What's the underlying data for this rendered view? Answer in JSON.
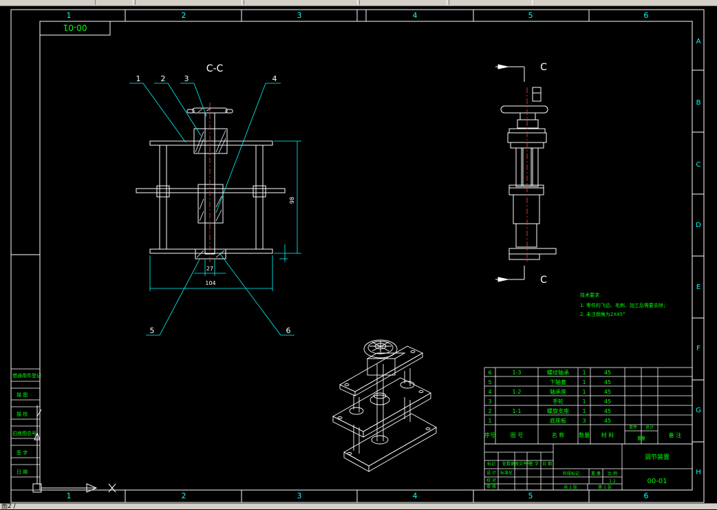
{
  "border": {
    "columns": [
      "1",
      "2",
      "3",
      "4",
      "5",
      "6"
    ],
    "rows": [
      "A",
      "B",
      "C",
      "D",
      "E",
      "F",
      "G",
      "H"
    ],
    "mirrored_code": "00-01"
  },
  "section_view": {
    "title": "C-C",
    "balloons": [
      "1",
      "2",
      "3",
      "4",
      "5",
      "6"
    ],
    "dim_height": "98",
    "dim_inner": "27",
    "dim_width": "104"
  },
  "side_view": {
    "section_mark_top": "C",
    "section_mark_bottom": "C"
  },
  "tech_notes": {
    "title": "技术要求",
    "lines": [
      "1. 零件的飞边、毛刺、加工后需要去除；",
      "2. 未注倒角为2X45°"
    ]
  },
  "bom": {
    "rows": [
      {
        "no": "6",
        "code": "1-3",
        "name": "螺纹轴承",
        "qty": "1",
        "material": "45"
      },
      {
        "no": "5",
        "code": "",
        "name": "下轴套",
        "qty": "1",
        "material": "45"
      },
      {
        "no": "4",
        "code": "1-2",
        "name": "轴承座",
        "qty": "1",
        "material": "45"
      },
      {
        "no": "3",
        "code": "",
        "name": "手轮",
        "qty": "1",
        "material": "45"
      },
      {
        "no": "2",
        "code": "1-1",
        "name": "螺旋支座",
        "qty": "1",
        "material": "45"
      },
      {
        "no": "1",
        "code": "",
        "name": "底座板",
        "qty": "3",
        "material": "45"
      }
    ],
    "header": {
      "no": "序号",
      "code": "图 号",
      "name": "名 称",
      "qty": "数量",
      "material": "材 料",
      "weight_single": "单件",
      "weight_total": "总计",
      "weight": "重量",
      "remark": "备 注"
    }
  },
  "title_block": {
    "drawing_name": "调节装置",
    "drawing_code": "00-01",
    "stage_label": "阶段标记",
    "weight_label": "重 量",
    "scale_label": "比 例",
    "scale_value": "1:2",
    "sheets_total": "共 1 张",
    "sheet_no": "第 1 张",
    "mark_cols": [
      "标记",
      "处数",
      "更改文件号",
      "签 字",
      "日 期"
    ],
    "sign_rows": [
      "设 计",
      "标准化",
      "校 对",
      "审 核",
      "工 艺",
      "批 准"
    ]
  },
  "left_panel": [
    "借通用件登记",
    "描 图",
    "描 校",
    "旧底图总号",
    "签 字",
    "日 期"
  ],
  "status": {
    "text": "图2 /"
  },
  "colors": {
    "frame": "#ffffff",
    "section_lines": "#ffffff",
    "dimension": "#00ffff",
    "notes": "#00ff00",
    "table_text": "#00ff00",
    "grid_cyan": "#00ffff"
  }
}
